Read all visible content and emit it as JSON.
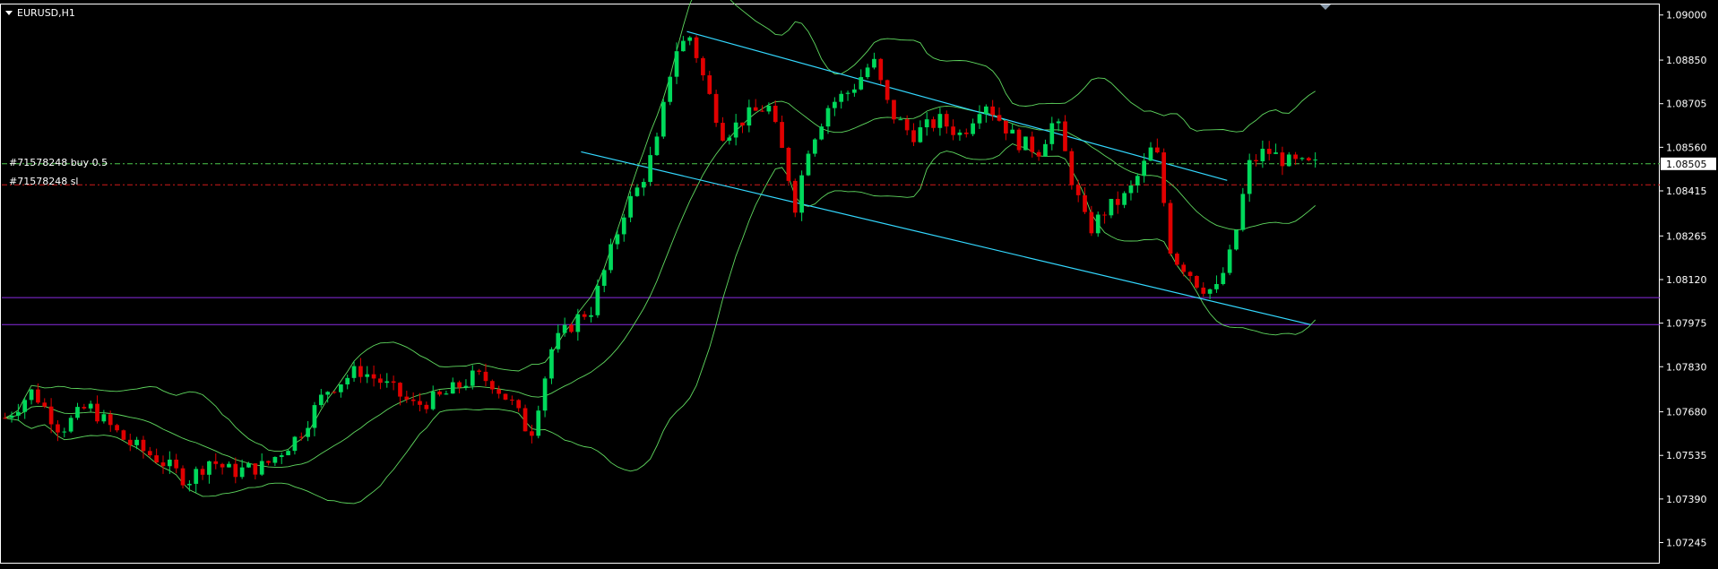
{
  "window": {
    "symbol_label": "EURUSD,H1"
  },
  "colors": {
    "background": "#000000",
    "axis": "#FFFFFF",
    "bull_candle": "#00D95B",
    "bear_candle": "#E00000",
    "bollinger": "#5FD85F",
    "channel": "#33D8FF",
    "order_line": "#4CC94C",
    "stop_loss_line": "#D11B1B",
    "horizontal_level": "#8A2BE2",
    "price_box_bg": "#FFFFFF",
    "price_box_text": "#000000"
  },
  "order_labels": {
    "buy_label": "#71578248 buy 0.5",
    "sl_label": "#71578248 sl"
  },
  "chart_data": {
    "type": "candlestick",
    "symbol": "EURUSD",
    "timeframe": "H1",
    "ylim": [
      1.07175,
      1.09035
    ],
    "y_ticks": [
      1.09,
      1.0885,
      1.08705,
      1.0856,
      1.08415,
      1.08265,
      1.0812,
      1.07975,
      1.0783,
      1.0768,
      1.07535,
      1.0739,
      1.07245
    ],
    "y_tick_labels": [
      "1.09000",
      "1.08850",
      "1.08705",
      "1.08560",
      "1.08415",
      "1.08265",
      "1.08120",
      "1.07975",
      "1.07830",
      "1.07680",
      "1.07535",
      "1.07390",
      "1.07245"
    ],
    "current_price": 1.08505,
    "current_price_label": "1.08505",
    "bar_count": 200,
    "grid": false,
    "candle_path": [
      [
        0,
        1.0766
      ],
      [
        5,
        1.0775
      ],
      [
        10,
        1.0762
      ],
      [
        15,
        1.077
      ],
      [
        22,
        1.0758
      ],
      [
        28,
        1.0752
      ],
      [
        33,
        1.0745
      ],
      [
        37,
        1.0752
      ],
      [
        41,
        1.0748
      ],
      [
        47,
        1.075
      ],
      [
        53,
        1.076
      ],
      [
        58,
        1.0775
      ],
      [
        64,
        1.0782
      ],
      [
        68,
        1.0778
      ],
      [
        74,
        1.077
      ],
      [
        79,
        1.0773
      ],
      [
        85,
        1.078
      ],
      [
        88,
        1.0778
      ],
      [
        92,
        1.077
      ],
      [
        95,
        1.076
      ],
      [
        99,
        1.079
      ],
      [
        104,
        1.08
      ],
      [
        106,
        1.0802
      ],
      [
        109,
        1.0818
      ],
      [
        112,
        1.0835
      ],
      [
        115,
        1.0844
      ],
      [
        118,
        1.0858
      ],
      [
        121,
        1.0888
      ],
      [
        124,
        1.0893
      ],
      [
        127,
        1.0875
      ],
      [
        130,
        1.086
      ],
      [
        134,
        1.0866
      ],
      [
        138,
        1.087
      ],
      [
        141,
        1.0852
      ],
      [
        143,
        1.0836
      ],
      [
        145,
        1.0855
      ],
      [
        149,
        1.087
      ],
      [
        153,
        1.0875
      ],
      [
        157,
        1.0885
      ],
      [
        160,
        1.0868
      ],
      [
        164,
        1.086
      ],
      [
        169,
        1.0865
      ],
      [
        173,
        1.086
      ],
      [
        177,
        1.0872
      ],
      [
        180,
        1.0865
      ],
      [
        183,
        1.0858
      ],
      [
        187,
        1.0855
      ],
      [
        190,
        1.0866
      ],
      [
        193,
        1.0845
      ],
      [
        196,
        1.0828
      ],
      [
        199,
        1.0835
      ],
      [
        203,
        1.084
      ],
      [
        206,
        1.085
      ],
      [
        208,
        1.0858
      ],
      [
        211,
        1.082
      ],
      [
        214,
        1.0815
      ],
      [
        216,
        1.081
      ],
      [
        219,
        1.0808
      ],
      [
        222,
        1.0822
      ],
      [
        225,
        1.085
      ],
      [
        228,
        1.0855
      ],
      [
        232,
        1.0851
      ],
      [
        235,
        1.085
      ],
      [
        237,
        1.085
      ]
    ],
    "bollinger_period": 20,
    "bollinger_deviation": 2,
    "trend_channel": {
      "upper": [
        [
          123,
          1.08945
        ],
        [
          167,
          1.0872
        ],
        [
          220,
          1.0845
        ]
      ],
      "lower": [
        [
          104,
          1.08545
        ],
        [
          235,
          1.0797
        ]
      ]
    },
    "horizontal_levels": [
      {
        "price": 1.08505,
        "style": "dash-dot",
        "role": "order"
      },
      {
        "price": 1.08435,
        "style": "dash-dot",
        "role": "stop_loss"
      },
      {
        "price": 1.0806,
        "style": "solid",
        "role": "level"
      },
      {
        "price": 1.0797,
        "style": "solid",
        "role": "level"
      }
    ]
  }
}
